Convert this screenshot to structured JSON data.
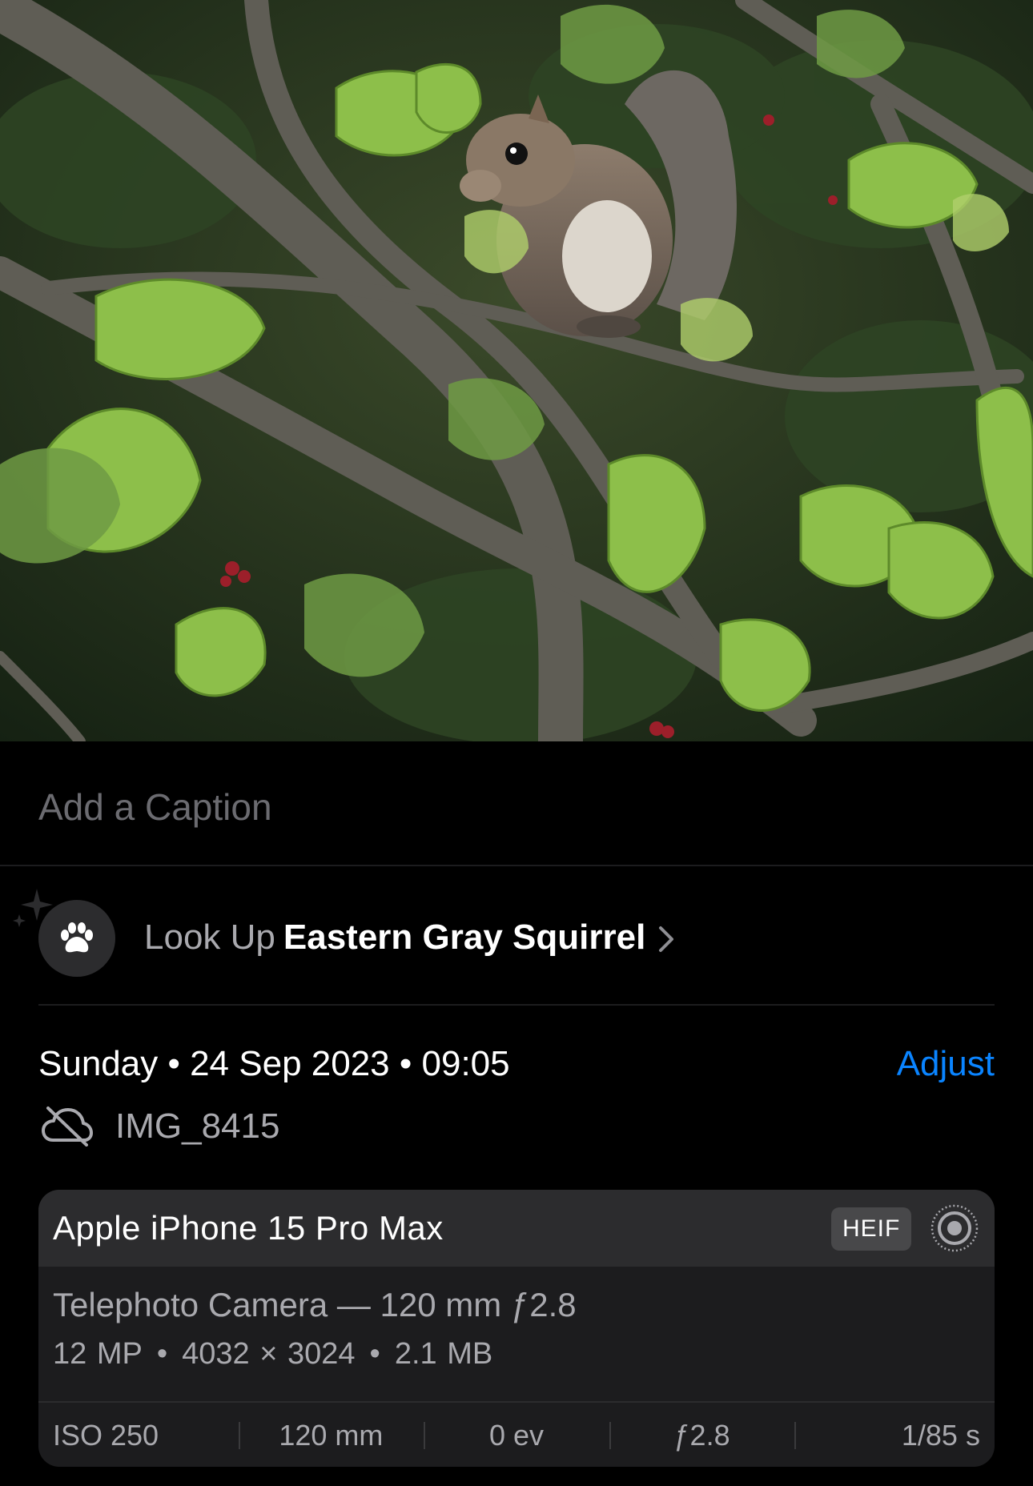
{
  "photo": {
    "subject": "Eastern Gray Squirrel",
    "icon": "squirrel-photo"
  },
  "caption": {
    "placeholder": "Add a Caption",
    "value": ""
  },
  "lookup": {
    "prefix": "Look Up",
    "subject": "Eastern Gray Squirrel",
    "icon": "paw-icon"
  },
  "meta": {
    "date": "Sunday • 24 Sep 2023 • 09:05",
    "adjust_label": "Adjust",
    "filename": "IMG_8415",
    "cloud_icon": "cloud-off-icon"
  },
  "camera": {
    "device": "Apple iPhone 15 Pro Max",
    "format_badge": "HEIF",
    "lens": "Telephoto Camera — 120 mm ƒ2.8",
    "megapixels": "12 MP",
    "resolution": "4032 × 3024",
    "filesize": "2.1 MB",
    "exif": [
      "ISO 250",
      "120 mm",
      "0 ev",
      "ƒ2.8",
      "1/85 s"
    ]
  },
  "colors": {
    "accent": "#0a84ff",
    "background": "#000000",
    "card": "#1c1c1e",
    "card_header": "#2c2c2e",
    "secondary_text": "#a9a9ae"
  }
}
